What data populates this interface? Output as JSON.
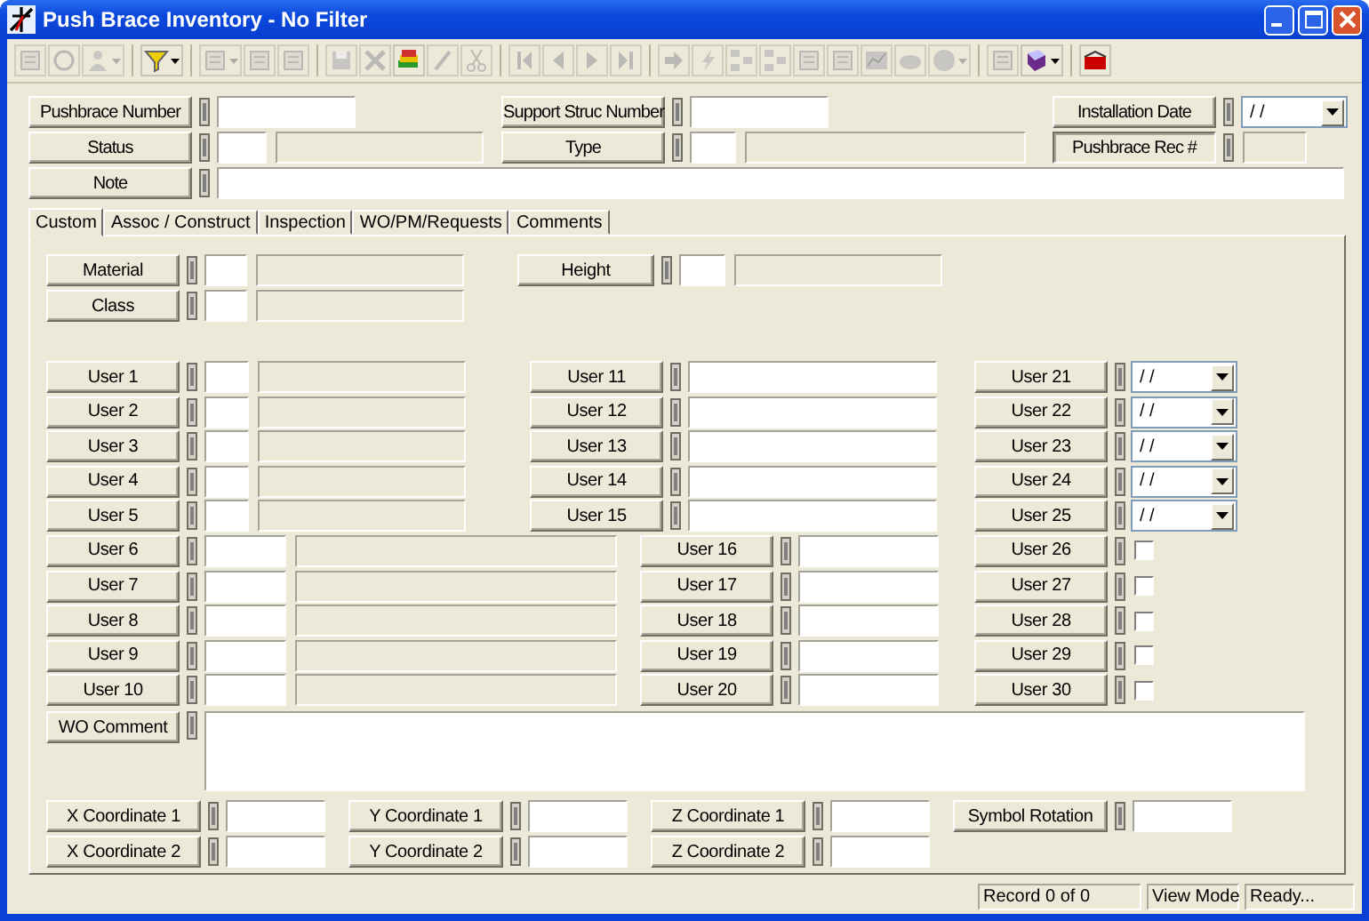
{
  "window": {
    "title": "Push Brace Inventory - No Filter"
  },
  "toolbar": [
    [
      {
        "disabled": true,
        "dropdown": false
      },
      {
        "disabled": true,
        "dropdown": false
      },
      {
        "disabled": true,
        "dropdown": true
      }
    ],
    [
      {
        "disabled": false,
        "dropdown": true
      }
    ],
    [
      {
        "disabled": true,
        "dropdown": true
      },
      {
        "disabled": true,
        "dropdown": false
      },
      {
        "disabled": true,
        "dropdown": false
      }
    ],
    [
      {
        "disabled": true,
        "dropdown": false
      },
      {
        "disabled": true,
        "dropdown": false
      },
      {
        "disabled": false,
        "dropdown": false
      },
      {
        "disabled": true,
        "dropdown": false
      },
      {
        "disabled": true,
        "dropdown": false
      }
    ],
    [
      {
        "disabled": true,
        "dropdown": false
      },
      {
        "disabled": true,
        "dropdown": false
      },
      {
        "disabled": true,
        "dropdown": false
      },
      {
        "disabled": true,
        "dropdown": false
      }
    ],
    [
      {
        "disabled": true,
        "dropdown": false
      },
      {
        "disabled": true,
        "dropdown": false
      },
      {
        "disabled": true,
        "dropdown": false
      },
      {
        "disabled": true,
        "dropdown": false
      },
      {
        "disabled": true,
        "dropdown": false
      },
      {
        "disabled": true,
        "dropdown": false
      },
      {
        "disabled": true,
        "dropdown": false
      },
      {
        "disabled": true,
        "dropdown": false
      },
      {
        "disabled": true,
        "dropdown": true
      }
    ],
    [
      {
        "disabled": true,
        "dropdown": false
      },
      {
        "disabled": false,
        "dropdown": true
      }
    ],
    [
      {
        "disabled": false,
        "dropdown": false
      }
    ]
  ],
  "header": {
    "rows": [
      [
        {
          "label": "Pushbrace Number",
          "kind": "text"
        },
        {
          "label": "Support Struc Number",
          "kind": "text"
        },
        {
          "label": "Installation Date",
          "kind": "date",
          "value": "/ /"
        }
      ],
      [
        {
          "label": "Status",
          "kind": "code"
        },
        {
          "label": "Type",
          "kind": "code"
        },
        {
          "label": "Pushbrace Rec #",
          "kind": "readonly"
        }
      ],
      [
        {
          "label": "Note",
          "kind": "text"
        }
      ]
    ]
  },
  "tabs": [
    {
      "label": "Custom",
      "selected": true
    },
    {
      "label": "Assoc / Construct",
      "selected": false
    },
    {
      "label": "Inspection",
      "selected": false
    },
    {
      "label": "WO/PM/Requests",
      "selected": false
    },
    {
      "label": "Comments",
      "selected": false
    }
  ],
  "custom": {
    "top_rows": [
      [
        {
          "label": "Material",
          "kind": "code"
        },
        {
          "label": "Height",
          "kind": "code"
        }
      ],
      [
        {
          "label": "Class",
          "kind": "code"
        }
      ]
    ],
    "user_rows": [
      [
        {
          "label": "User 1",
          "kind": "code"
        },
        {
          "label": "User 11",
          "kind": "text"
        },
        {
          "label": "User 21",
          "kind": "date",
          "value": "/ /"
        }
      ],
      [
        {
          "label": "User 2",
          "kind": "code"
        },
        {
          "label": "User 12",
          "kind": "text"
        },
        {
          "label": "User 22",
          "kind": "date",
          "value": "/ /"
        }
      ],
      [
        {
          "label": "User 3",
          "kind": "code"
        },
        {
          "label": "User 13",
          "kind": "text"
        },
        {
          "label": "User 23",
          "kind": "date",
          "value": "/ /"
        }
      ],
      [
        {
          "label": "User 4",
          "kind": "code"
        },
        {
          "label": "User 14",
          "kind": "text"
        },
        {
          "label": "User 24",
          "kind": "date",
          "value": "/ /"
        }
      ],
      [
        {
          "label": "User 5",
          "kind": "code"
        },
        {
          "label": "User 15",
          "kind": "text"
        },
        {
          "label": "User 25",
          "kind": "date",
          "value": "/ /"
        }
      ]
    ],
    "user_rows_2": [
      [
        {
          "label": "User 6",
          "kind": "code"
        },
        {
          "label": "User 16",
          "kind": "text"
        },
        {
          "label": "User 26",
          "kind": "check",
          "checked": false
        }
      ],
      [
        {
          "label": "User 7",
          "kind": "code"
        },
        {
          "label": "User 17",
          "kind": "text"
        },
        {
          "label": "User 27",
          "kind": "check",
          "checked": false
        }
      ],
      [
        {
          "label": "User 8",
          "kind": "code"
        },
        {
          "label": "User 18",
          "kind": "text"
        },
        {
          "label": "User 28",
          "kind": "check",
          "checked": false
        }
      ],
      [
        {
          "label": "User 9",
          "kind": "code"
        },
        {
          "label": "User 19",
          "kind": "text"
        },
        {
          "label": "User 29",
          "kind": "check",
          "checked": false
        }
      ],
      [
        {
          "label": "User 10",
          "kind": "code"
        },
        {
          "label": "User 20",
          "kind": "text"
        },
        {
          "label": "User 30",
          "kind": "check",
          "checked": false
        }
      ]
    ],
    "comment_rows": [
      [
        {
          "label": "WO Comment",
          "kind": "memo"
        }
      ]
    ],
    "coordinate_rows": [
      [
        {
          "label": "X Coordinate 1",
          "kind": "text"
        },
        {
          "label": "Y Coordinate 1",
          "kind": "text"
        },
        {
          "label": "Z Coordinate 1",
          "kind": "text"
        },
        {
          "label": "Symbol Rotation",
          "kind": "text"
        }
      ],
      [
        {
          "label": "X Coordinate 2",
          "kind": "text"
        },
        {
          "label": "Y Coordinate 2",
          "kind": "text"
        },
        {
          "label": "Z Coordinate 2",
          "kind": "text"
        }
      ]
    ]
  },
  "status_bar": [
    "Record 0 of 0",
    "View Mode",
    "Ready..."
  ]
}
